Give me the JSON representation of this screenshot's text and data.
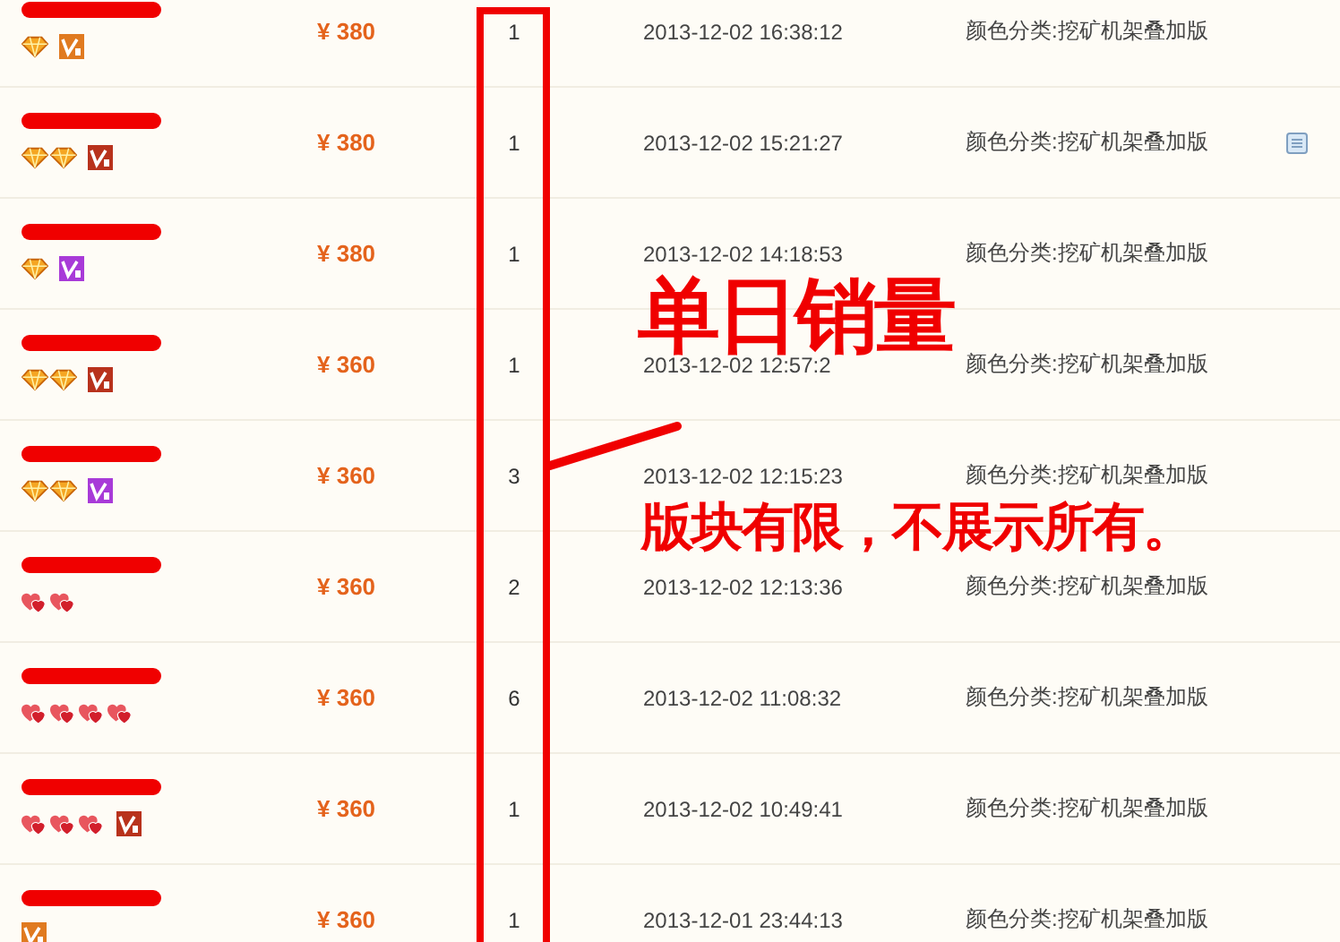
{
  "rows": [
    {
      "price": "¥ 380",
      "quantity": "1",
      "time": "2013-12-02 16:38:12",
      "variant": "颜色分类:挖矿机架叠加版",
      "credit_icons": [
        {
          "kind": "diamond"
        }
      ],
      "vip": {
        "color": "#e07a20"
      },
      "note_icon": false
    },
    {
      "price": "¥ 380",
      "quantity": "1",
      "time": "2013-12-02 15:21:27",
      "variant": "颜色分类:挖矿机架叠加版",
      "credit_icons": [
        {
          "kind": "diamond"
        },
        {
          "kind": "diamond"
        }
      ],
      "vip": {
        "color": "#b8321c"
      },
      "note_icon": true
    },
    {
      "price": "¥ 380",
      "quantity": "1",
      "time": "2013-12-02 14:18:53",
      "variant": "颜色分类:挖矿机架叠加版",
      "credit_icons": [
        {
          "kind": "diamond"
        }
      ],
      "vip": {
        "color": "#a83ad8"
      },
      "note_icon": false
    },
    {
      "price": "¥ 360",
      "quantity": "1",
      "time": "2013-12-02 12:57:2",
      "variant": "颜色分类:挖矿机架叠加版",
      "credit_icons": [
        {
          "kind": "diamond"
        },
        {
          "kind": "diamond"
        }
      ],
      "vip": {
        "color": "#b8321c"
      },
      "note_icon": false
    },
    {
      "price": "¥ 360",
      "quantity": "3",
      "time": "2013-12-02 12:15:23",
      "variant": "颜色分类:挖矿机架叠加版",
      "credit_icons": [
        {
          "kind": "diamond"
        },
        {
          "kind": "diamond"
        }
      ],
      "vip": {
        "color": "#a83ad8"
      },
      "note_icon": false
    },
    {
      "price": "¥ 360",
      "quantity": "2",
      "time": "2013-12-02 12:13:36",
      "variant": "颜色分类:挖矿机架叠加版",
      "credit_icons": [
        {
          "kind": "heart"
        },
        {
          "kind": "heart"
        }
      ],
      "vip": null,
      "note_icon": false
    },
    {
      "price": "¥ 360",
      "quantity": "6",
      "time": "2013-12-02 11:08:32",
      "variant": "颜色分类:挖矿机架叠加版",
      "credit_icons": [
        {
          "kind": "heart"
        },
        {
          "kind": "heart"
        },
        {
          "kind": "heart"
        },
        {
          "kind": "heart"
        }
      ],
      "vip": null,
      "note_icon": false
    },
    {
      "price": "¥ 360",
      "quantity": "1",
      "time": "2013-12-02 10:49:41",
      "variant": "颜色分类:挖矿机架叠加版",
      "credit_icons": [
        {
          "kind": "heart"
        },
        {
          "kind": "heart"
        },
        {
          "kind": "heart"
        }
      ],
      "vip": {
        "color": "#b8321c"
      },
      "note_icon": false
    },
    {
      "price": "¥ 360",
      "quantity": "1",
      "time": "2013-12-01 23:44:13",
      "variant": "颜色分类:挖矿机架叠加版",
      "credit_icons": [],
      "vip": {
        "color": "#e07a20"
      },
      "note_icon": false
    }
  ],
  "annotation": {
    "title": "单日销量",
    "subtitle": "版块有限，不展示所有。"
  }
}
